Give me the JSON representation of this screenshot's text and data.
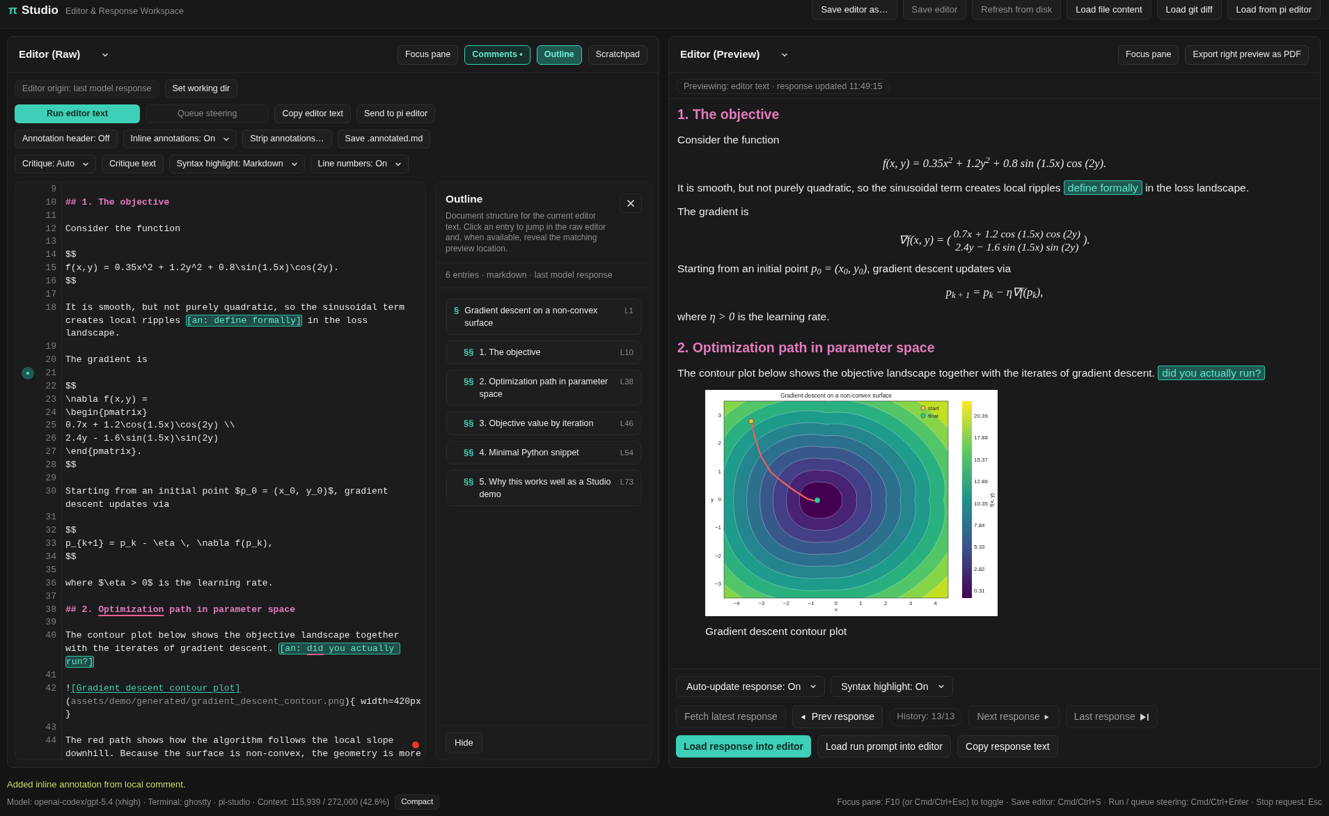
{
  "app": {
    "logo_symbol": "π",
    "name": "Studio",
    "subtitle": "Editor & Response Workspace"
  },
  "top_actions": [
    {
      "label": "Save editor as…",
      "disabled": false
    },
    {
      "label": "Save editor",
      "disabled": true
    },
    {
      "label": "Refresh from disk",
      "disabled": true
    },
    {
      "label": "Load file content",
      "disabled": false
    },
    {
      "label": "Load git diff",
      "disabled": false
    },
    {
      "label": "Load from pi editor",
      "disabled": false
    }
  ],
  "left_pane": {
    "title": "Editor (Raw)",
    "header_buttons": [
      {
        "label": "Focus pane",
        "kind": "button",
        "selected": false
      },
      {
        "label": "Comments •",
        "kind": "indicator",
        "selected": true
      },
      {
        "label": "Outline",
        "kind": "button",
        "selected": true
      },
      {
        "label": "Scratchpad",
        "kind": "button",
        "selected": false
      }
    ],
    "control_rows": [
      [
        {
          "kind": "tag",
          "label": "Editor origin: last model response"
        },
        {
          "kind": "button",
          "label": "Set working dir",
          "disabled": false
        }
      ],
      [
        {
          "kind": "primary",
          "label": "Run editor text"
        },
        {
          "kind": "button",
          "label": "Queue steering",
          "disabled": true
        },
        {
          "kind": "button",
          "label": "Copy editor text",
          "disabled": false
        },
        {
          "kind": "button",
          "label": "Send to pi editor",
          "disabled": false
        }
      ],
      [
        {
          "kind": "button",
          "label": "Annotation header: Off",
          "disabled": false
        },
        {
          "kind": "select",
          "label": "Inline annotations: On"
        },
        {
          "kind": "button",
          "label": "Strip annotations…",
          "disabled": false
        },
        {
          "kind": "button",
          "label": "Save .annotated.md",
          "disabled": false
        }
      ],
      [
        {
          "kind": "select",
          "label": "Critique: Auto"
        },
        {
          "kind": "button",
          "label": "Critique text",
          "disabled": false
        },
        {
          "kind": "select",
          "label": "Syntax highlight: Markdown"
        },
        {
          "kind": "select",
          "label": "Line numbers: On"
        }
      ]
    ],
    "editor_lines": [
      {
        "number": "9",
        "comment": false,
        "alert": false
      },
      {
        "number": "10",
        "comment": false,
        "alert": false,
        "segments": [
          {
            "kind": "heading",
            "text": "## 1. The objective"
          }
        ]
      },
      {
        "number": "11",
        "comment": false,
        "alert": false
      },
      {
        "number": "12",
        "comment": false,
        "alert": false,
        "segments": [
          {
            "kind": "plain",
            "text": "Consider the function"
          }
        ]
      },
      {
        "number": "13",
        "comment": false,
        "alert": false
      },
      {
        "number": "14",
        "comment": false,
        "alert": false,
        "segments": [
          {
            "kind": "plain",
            "text": "$$"
          }
        ]
      },
      {
        "number": "15",
        "comment": false,
        "alert": false,
        "segments": [
          {
            "kind": "plain",
            "text": "f(x,y) = 0.35x^2 + 1.2y^2 + 0.8\\sin(1.5x)\\cos(2y)."
          }
        ]
      },
      {
        "number": "16",
        "comment": false,
        "alert": false,
        "segments": [
          {
            "kind": "plain",
            "text": "$$"
          }
        ]
      },
      {
        "number": "17",
        "comment": false,
        "alert": false
      },
      {
        "number": "18",
        "comment": false,
        "alert": false,
        "segments": [
          {
            "kind": "plain",
            "text": "It is smooth, but not purely quadratic, so the sinusoidal term creates local ripples "
          },
          {
            "kind": "annotation",
            "text": "[an: define formally]"
          },
          {
            "kind": "plain",
            "text": " in the loss landscape."
          }
        ]
      },
      {
        "number": "19",
        "comment": false,
        "alert": false
      },
      {
        "number": "20",
        "comment": false,
        "alert": false,
        "segments": [
          {
            "kind": "plain",
            "text": "The gradient is"
          }
        ]
      },
      {
        "number": "21",
        "comment": true,
        "alert": false
      },
      {
        "number": "22",
        "comment": false,
        "alert": false,
        "segments": [
          {
            "kind": "plain",
            "text": "$$"
          }
        ]
      },
      {
        "number": "23",
        "comment": false,
        "alert": false,
        "segments": [
          {
            "kind": "plain",
            "text": "\\nabla f(x,y) ="
          }
        ]
      },
      {
        "number": "24",
        "comment": false,
        "alert": false,
        "segments": [
          {
            "kind": "plain",
            "text": "\\begin{pmatrix}"
          }
        ]
      },
      {
        "number": "25",
        "comment": false,
        "alert": false,
        "segments": [
          {
            "kind": "plain",
            "text": "0.7x + 1.2\\cos(1.5x)\\cos(2y) \\\\"
          }
        ]
      },
      {
        "number": "26",
        "comment": false,
        "alert": false,
        "segments": [
          {
            "kind": "plain",
            "text": "2.4y - 1.6\\sin(1.5x)\\sin(2y)"
          }
        ]
      },
      {
        "number": "27",
        "comment": false,
        "alert": false,
        "segments": [
          {
            "kind": "plain",
            "text": "\\end{pmatrix}."
          }
        ]
      },
      {
        "number": "28",
        "comment": false,
        "alert": false,
        "segments": [
          {
            "kind": "plain",
            "text": "$$"
          }
        ]
      },
      {
        "number": "29",
        "comment": false,
        "alert": false
      },
      {
        "number": "30",
        "comment": false,
        "alert": false,
        "segments": [
          {
            "kind": "plain",
            "text": "Starting from an initial point $p_0 = (x_0, y_0)$, gradient descent updates via"
          }
        ]
      },
      {
        "number": "31",
        "comment": false,
        "alert": false
      },
      {
        "number": "32",
        "comment": false,
        "alert": false,
        "segments": [
          {
            "kind": "plain",
            "text": "$$"
          }
        ]
      },
      {
        "number": "33",
        "comment": false,
        "alert": false,
        "segments": [
          {
            "kind": "plain",
            "text": "p_{k+1} = p_k - \\eta \\, \\nabla f(p_k),"
          }
        ]
      },
      {
        "number": "34",
        "comment": false,
        "alert": false,
        "segments": [
          {
            "kind": "plain",
            "text": "$$"
          }
        ]
      },
      {
        "number": "35",
        "comment": false,
        "alert": false
      },
      {
        "number": "36",
        "comment": false,
        "alert": false,
        "segments": [
          {
            "kind": "plain",
            "text": "where $\\eta > 0$ is the learning rate."
          }
        ]
      },
      {
        "number": "37",
        "comment": false,
        "alert": false
      },
      {
        "number": "38",
        "comment": false,
        "alert": false,
        "segments": [
          {
            "kind": "heading",
            "text": "## 2. ",
            "misspelled": false
          },
          {
            "kind": "heading",
            "text": "Optimization",
            "misspelled": true
          },
          {
            "kind": "heading",
            "text": " path in parameter space",
            "misspelled": false
          }
        ]
      },
      {
        "number": "39",
        "comment": false,
        "alert": false
      },
      {
        "number": "40",
        "comment": false,
        "alert": false,
        "segments": [
          {
            "kind": "plain",
            "text": "The contour plot below shows the objective landscape together with the iterates of gradient descent. ",
            "misspelled": false
          },
          {
            "kind": "annotation",
            "text": "[an: ",
            "misspelled": false
          },
          {
            "kind": "annotation-part",
            "text": "did",
            "misspelled": true
          },
          {
            "kind": "annotation-part",
            "text": " you actually ",
            "misspelled": false
          },
          {
            "kind": "annotation",
            "text": "run?]",
            "misspelled": false
          }
        ]
      },
      {
        "number": "41",
        "comment": false,
        "alert": false
      },
      {
        "number": "42",
        "comment": false,
        "alert": false,
        "segments": [
          {
            "kind": "plain",
            "text": "!"
          },
          {
            "kind": "link",
            "text": "[Gradient descent contour plot]"
          },
          {
            "kind": "plain",
            "text": "("
          },
          {
            "kind": "muted",
            "text": "assets/demo/generated/gradient_descent_contour.png"
          },
          {
            "kind": "plain",
            "text": "){ width=420px }"
          }
        ]
      },
      {
        "number": "43",
        "comment": false,
        "alert": false
      },
      {
        "number": "44",
        "comment": false,
        "alert": true,
        "segments": [
          {
            "kind": "plain",
            "text": "The red path shows how the algorithm follows the local slope downhill. Because the surface is non-convex, the geometry is more"
          }
        ]
      }
    ]
  },
  "outline": {
    "title": "Outline",
    "description": "Document structure for the current editor text. Click an entry to jump in the raw editor and, when available, reveal the matching preview location.",
    "meta": "6 entries · markdown · last model response",
    "entries": [
      {
        "marker": "§",
        "title": "Gradient descent on a non-convex surface",
        "line": "L1",
        "children": [
          {
            "marker": "§§",
            "title": "1. The objective",
            "line": "L10"
          },
          {
            "marker": "§§",
            "title": "2. Optimization path in parameter space",
            "line": "L38"
          },
          {
            "marker": "§§",
            "title": "3. Objective value by iteration",
            "line": "L46"
          },
          {
            "marker": "§§",
            "title": "4. Minimal Python snippet",
            "line": "L54"
          },
          {
            "marker": "§§",
            "title": "5. Why this works well as a Studio demo",
            "line": "L73"
          }
        ]
      }
    ],
    "hide_button": "Hide"
  },
  "right_pane": {
    "title": "Editor (Preview)",
    "header_buttons": [
      "Focus pane",
      "Export right preview as PDF"
    ],
    "status": "Previewing: editor text · response updated 11:49:15",
    "blocks": [
      {
        "kind": "heading",
        "text": "1. The objective"
      },
      {
        "kind": "paragraph",
        "parts": [
          {
            "kind": "text",
            "text": "Consider the function"
          }
        ]
      },
      {
        "kind": "equation",
        "text": "f(x, y) = 0.35x$^{2}$ + 1.2y$^{2}$ + 0.8 sin (1.5x) cos (2y)."
      },
      {
        "kind": "paragraph",
        "parts": [
          {
            "kind": "text",
            "text": "It is smooth, but not purely quadratic, so the sinusoidal term creates local ripples "
          },
          {
            "kind": "annotation",
            "text": "define formally"
          },
          {
            "kind": "text",
            "text": " in the loss landscape."
          }
        ]
      },
      {
        "kind": "paragraph",
        "parts": [
          {
            "kind": "text",
            "text": "The gradient is"
          }
        ]
      },
      {
        "kind": "matrix",
        "lead": "∇f(x, y) = (",
        "rows": [
          "0.7x + 1.2 cos (1.5x) cos (2y)",
          "2.4y − 1.6 sin (1.5x) sin (2y)"
        ],
        "tail": ")."
      },
      {
        "kind": "paragraph",
        "parts": [
          {
            "kind": "text",
            "text": "Starting from an initial point "
          },
          {
            "kind": "math",
            "text": "p$_{0}$ = (x$_{0}$, y$_{0}$)"
          },
          {
            "kind": "text",
            "text": ", gradient descent updates via"
          }
        ]
      },
      {
        "kind": "equation",
        "text": "p$_{k + 1}$ = p$_{k}$ − η∇f(p$_{k}$),"
      },
      {
        "kind": "paragraph",
        "parts": [
          {
            "kind": "text",
            "text": "where "
          },
          {
            "kind": "math",
            "text": "η > 0"
          },
          {
            "kind": "text",
            "text": " is the learning rate."
          }
        ]
      },
      {
        "kind": "heading",
        "text": "2. Optimization path in parameter space"
      },
      {
        "kind": "paragraph",
        "parts": [
          {
            "kind": "text",
            "text": "The contour plot below shows the objective landscape together with the iterates of gradient descent. "
          },
          {
            "kind": "annotation",
            "text": "did you actually run?"
          }
        ]
      },
      {
        "kind": "figure",
        "title": "Gradient descent on a non-convex surface",
        "xticks": [
          "−4",
          "−3",
          "−2",
          "−1",
          "0",
          "1",
          "2",
          "3",
          "4"
        ],
        "yticks": [
          "3",
          "2",
          "1",
          "0",
          "−1",
          "−2",
          "−3"
        ],
        "xlabel": "x",
        "ylabel": "y",
        "colorbar_ticks": [
          "20.39",
          "17.88",
          "15.37",
          "12.86",
          "10.35",
          "7.84",
          "5.33",
          "2.82",
          "0.31"
        ],
        "colorbar_label": "f(x, y)",
        "legend": [
          {
            "label": "start",
            "color": "#f5b942"
          },
          {
            "label": "final",
            "color": "#2ecc9a"
          }
        ],
        "caption": "Gradient descent contour plot"
      }
    ],
    "selects": [
      "Auto-update response: On",
      "Syntax highlight: On"
    ],
    "nav": [
      {
        "kind": "plain",
        "label": "Fetch latest response",
        "disabled": true
      },
      {
        "kind": "prev",
        "label": "Prev response",
        "disabled": false
      },
      {
        "kind": "counter",
        "label": "History: 13/13"
      },
      {
        "kind": "next",
        "label": "Next response",
        "disabled": true
      },
      {
        "kind": "last",
        "label": "Last response",
        "disabled": true
      }
    ],
    "actions": [
      {
        "label": "Load response into editor",
        "primary": true
      },
      {
        "label": "Load run prompt into editor",
        "primary": false
      },
      {
        "label": "Copy response text",
        "primary": false
      }
    ]
  },
  "status_bar": {
    "message": "Added inline annotation from local comment.",
    "model_info": "Model: openai-codex/gpt-5.4 (xhigh) · Terminal: ghostty · pi-studio · Context: 115,939 / 272,000 (42.6%)",
    "compact_button": "Compact",
    "shortcuts": "Focus pane: F10 (or Cmd/Ctrl+Esc) to toggle · Save editor: Cmd/Ctrl+S · Run / queue steering: Cmd/Ctrl+Enter · Stop request: Esc"
  }
}
